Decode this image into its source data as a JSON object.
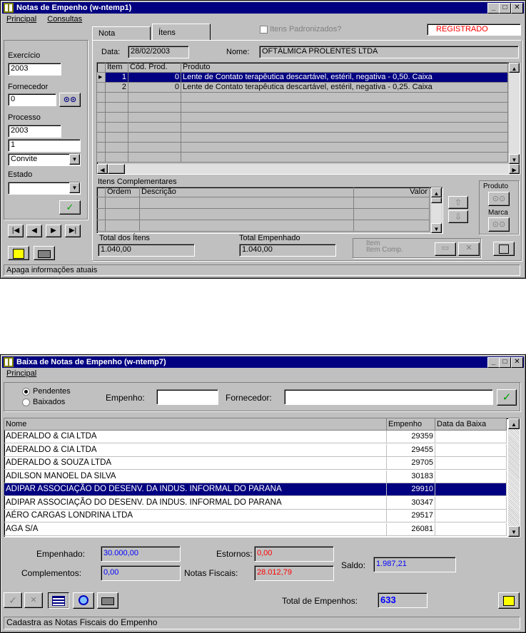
{
  "win1": {
    "title": "Notas de Empenho  (w-ntemp1)",
    "menu": [
      "Principal",
      "Consultas"
    ],
    "tabs": [
      "Nota",
      "Ítens"
    ],
    "padronizados_label": "Itens Padronizados?",
    "status": "REGISTRADO",
    "left": {
      "exercicio_label": "Exercício",
      "exercicio_value": "2003",
      "fornecedor_label": "Fornecedor",
      "fornecedor_value": "0",
      "processo_label": "Processo",
      "processo_year": "2003",
      "processo_num": "1",
      "modalidade": "Convite",
      "estado_label": "Estado",
      "estado_value": ""
    },
    "data_label": "Data:",
    "data_value": "28/02/2003",
    "nome_label": "Nome:",
    "nome_value": "OFTÁLMICA PROLENTES LTDA",
    "grid": {
      "headers": [
        "Ítem",
        "Cód. Prod.",
        "Produto"
      ],
      "rows": [
        {
          "item": "1",
          "cod": "0",
          "produto": "Lente de Contato terapêutica descartável, estéril, negativa - 0,50. Caixa"
        },
        {
          "item": "2",
          "cod": "0",
          "produto": "Lente de Contato terapêutica descartável, estéril, negativa - 0,25. Caixa"
        }
      ]
    },
    "complementares_label": "Itens Complementares",
    "comp_headers": [
      "Ordem",
      "Descrição",
      "Valor"
    ],
    "produto_label": "Produto",
    "marca_label": "Marca",
    "total_itens_label": "Total dos Ítens",
    "total_itens_value": "1.040,00",
    "total_empenhado_label": "Total Empenhado",
    "total_empenhado_value": "1.040,00",
    "item_radio": "Item",
    "item_comp_radio": "Item Comp.",
    "statusbar": "Apaga informações atuais"
  },
  "win2": {
    "title": "Baixa de Notas de Empenho  (w-ntemp7)",
    "menu": [
      "Principal"
    ],
    "radio_pendentes": "Pendentes",
    "radio_baixados": "Baixados",
    "empenho_label": "Empenho:",
    "empenho_value": "",
    "fornecedor_label": "Fornecedor:",
    "fornecedor_value": "",
    "grid_headers": [
      "Nome",
      "Empenho",
      "Data da Baixa"
    ],
    "rows": [
      {
        "nome": "ADERALDO & CIA LTDA",
        "empenho": "29359",
        "data": ""
      },
      {
        "nome": "ADERALDO & CIA LTDA",
        "empenho": "29455",
        "data": ""
      },
      {
        "nome": "ADERALDO & SOUZA  LTDA",
        "empenho": "29705",
        "data": ""
      },
      {
        "nome": "ADILSON MANOEL DA SILVA",
        "empenho": "30183",
        "data": ""
      },
      {
        "nome": "ADIPAR ASSOCIAÇÃO DO DESENV. DA INDUS. INFORMAL DO PARANA",
        "empenho": "29910",
        "data": ""
      },
      {
        "nome": "ADIPAR ASSOCIAÇÃO DO DESENV. DA INDUS. INFORMAL DO PARANA",
        "empenho": "30347",
        "data": ""
      },
      {
        "nome": "AÉRO CARGAS LONDRINA LTDA",
        "empenho": "29517",
        "data": ""
      },
      {
        "nome": "AGA S/A",
        "empenho": "26081",
        "data": ""
      }
    ],
    "empenhado_label": "Empenhado:",
    "empenhado_value": "30.000,00",
    "complementos_label": "Complementos:",
    "complementos_value": "0,00",
    "estornos_label": "Estornos:",
    "estornos_value": "0,00",
    "notas_label": "Notas Fiscais:",
    "notas_value": "28.012,79",
    "saldo_label": "Saldo:",
    "saldo_value": "1.987,21",
    "total_label": "Total de Empenhos:",
    "total_value": "633",
    "statusbar": "Cadastra as Notas Fiscais do Empenho"
  }
}
